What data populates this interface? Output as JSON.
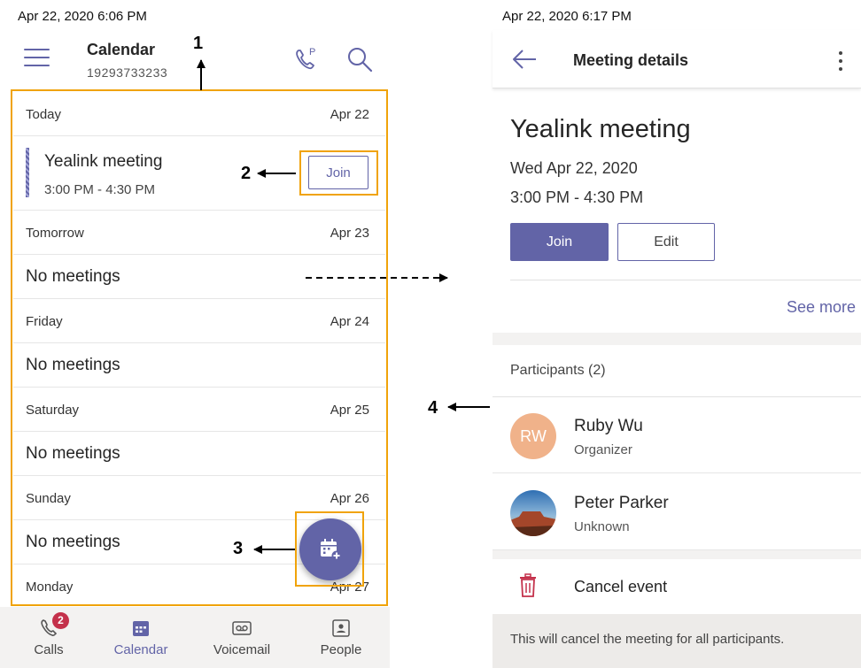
{
  "left": {
    "status": "Apr 22, 2020  6:06 PM",
    "header": {
      "title": "Calendar",
      "subtitle": "19293733233"
    },
    "days": [
      {
        "label": "Today",
        "date": "Apr 22"
      },
      {
        "label": "Tomorrow",
        "date": "Apr 23"
      },
      {
        "label": "Friday",
        "date": "Apr 24"
      },
      {
        "label": "Saturday",
        "date": "Apr 25"
      },
      {
        "label": "Sunday",
        "date": "Apr 26"
      },
      {
        "label": "Monday",
        "date": "Apr 27"
      }
    ],
    "meeting": {
      "title": "Yealink meeting",
      "time": "3:00 PM - 4:30 PM",
      "join_label": "Join"
    },
    "no_meetings": "No meetings",
    "tabs": [
      {
        "label": "Calls",
        "icon": "phone-icon",
        "badge": "2"
      },
      {
        "label": "Calendar",
        "icon": "calendar-icon"
      },
      {
        "label": "Voicemail",
        "icon": "voicemail-icon"
      },
      {
        "label": "People",
        "icon": "contact-icon"
      }
    ]
  },
  "annotations": {
    "n1": "1",
    "n2": "2",
    "n3": "3",
    "n4": "4"
  },
  "right": {
    "status": "Apr 22, 2020  6:17 PM",
    "header": {
      "title": "Meeting details"
    },
    "meeting": {
      "title": "Yealink meeting",
      "date": "Wed Apr 22, 2020",
      "time": "3:00 PM - 4:30 PM",
      "join_label": "Join",
      "edit_label": "Edit",
      "see_more": "See more"
    },
    "participants_header": "Participants (2)",
    "participants": [
      {
        "initials": "RW",
        "name": "Ruby Wu",
        "role": "Organizer"
      },
      {
        "name": "Peter Parker",
        "role": "Unknown"
      }
    ],
    "cancel": {
      "label": "Cancel event",
      "note": "This will cancel the meeting for all participants."
    }
  },
  "colors": {
    "accent": "#6264a7",
    "annotation": "#f0a30a",
    "badge": "#c4314b",
    "danger": "#c4314b"
  }
}
